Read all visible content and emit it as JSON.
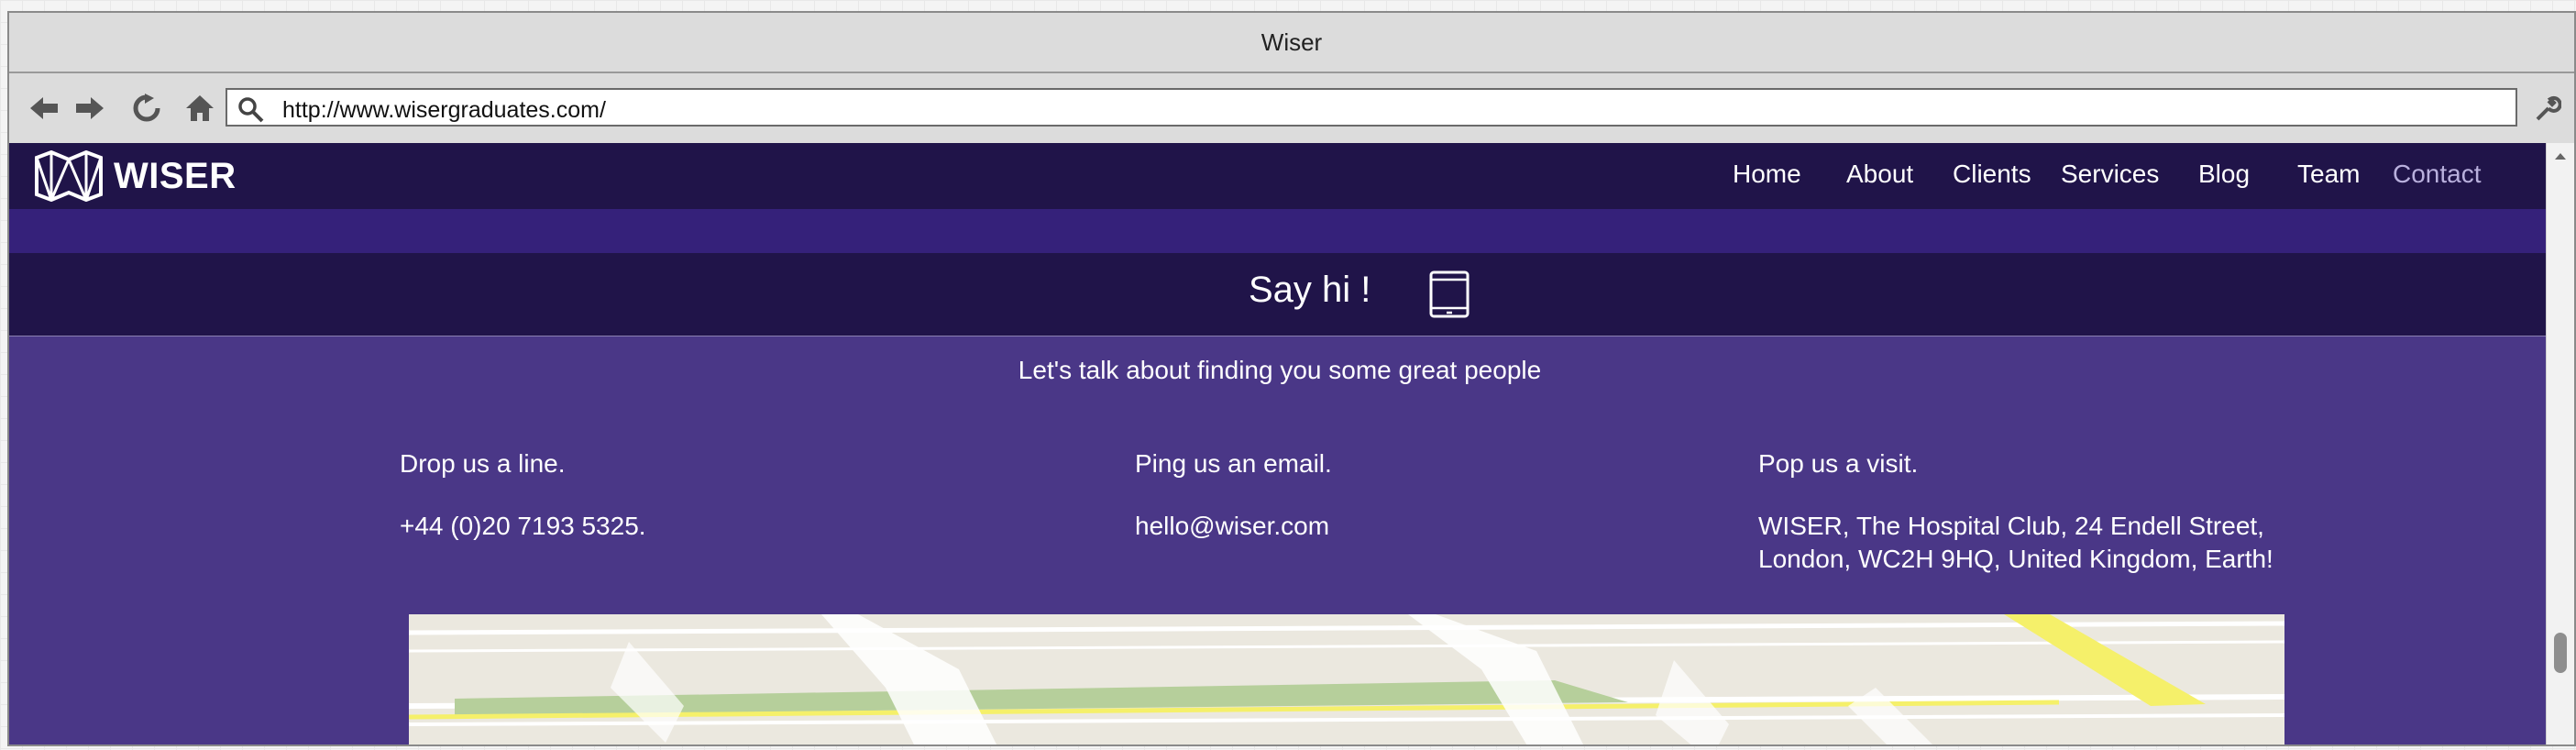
{
  "window": {
    "title": "Wiser"
  },
  "toolbar": {
    "back_icon": "back-arrow-icon",
    "forward_icon": "forward-arrow-icon",
    "reload_icon": "reload-icon",
    "home_icon": "home-icon",
    "search_icon": "search-icon",
    "url": "http://www.wisergraduates.com/",
    "settings_icon": "wrench-icon"
  },
  "site": {
    "logo_text": "WISER",
    "nav": [
      {
        "label": "Home"
      },
      {
        "label": "About"
      },
      {
        "label": "Clients"
      },
      {
        "label": "Services"
      },
      {
        "label": "Blog"
      },
      {
        "label": "Team"
      },
      {
        "label": "Contact"
      }
    ],
    "nav_active_color": "#b9b0dd",
    "hero_title": "Say hi !",
    "hero_icon": "tablet-icon",
    "tagline": "Let's talk about finding you some great people",
    "contact": {
      "phone": {
        "heading": "Drop us a line.",
        "value": "+44 (0)20 7193 5325."
      },
      "email": {
        "heading": "Ping us an email.",
        "value": "hello@wiser.com"
      },
      "visit": {
        "heading": "Pop us a visit.",
        "line1": "WISER, The Hospital Club, 24 Endell Street,",
        "line2": "London, WC2H 9HQ, United Kingdom, Earth!"
      }
    }
  },
  "colors": {
    "nav_bg": "#201449",
    "band": "#35217a",
    "content_bg": "#4a3787"
  }
}
